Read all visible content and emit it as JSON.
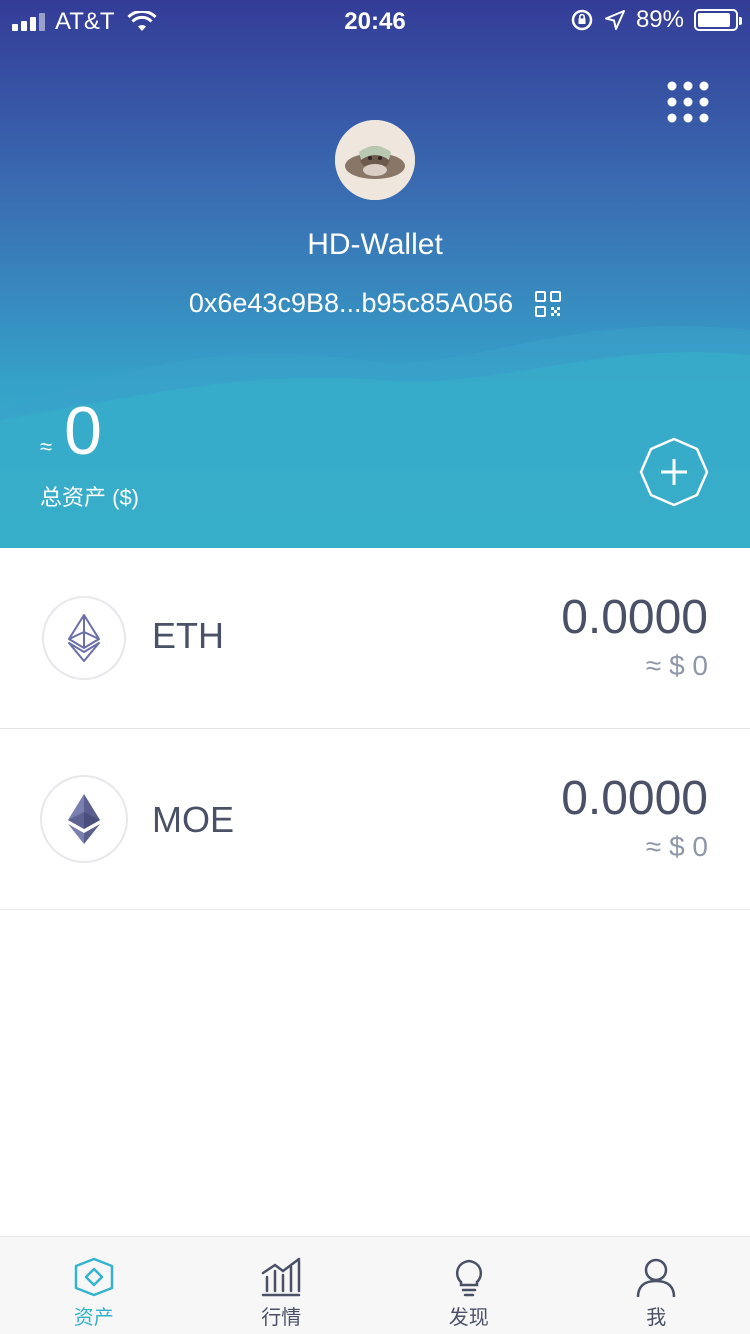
{
  "status_bar": {
    "carrier": "AT&T",
    "time": "20:46",
    "battery": "89%"
  },
  "header": {
    "wallet_name": "HD-Wallet",
    "address": "0x6e43c9B8...b95c85A056",
    "approx_symbol": "≈",
    "total_value": "0",
    "total_label": "总资产 ($)"
  },
  "assets": [
    {
      "symbol": "ETH",
      "balance": "0.0000",
      "fiat": "≈ $ 0",
      "icon": "ethereum-icon"
    },
    {
      "symbol": "MOE",
      "balance": "0.0000",
      "fiat": "≈ $ 0",
      "icon": "ethereum-icon"
    }
  ],
  "tabs": [
    {
      "label": "资产",
      "icon": "assets-icon",
      "active": true
    },
    {
      "label": "行情",
      "icon": "market-chart-icon",
      "active": false
    },
    {
      "label": "发现",
      "icon": "lightbulb-icon",
      "active": false
    },
    {
      "label": "我",
      "icon": "user-icon",
      "active": false
    }
  ],
  "colors": {
    "header_top": "#343c97",
    "header_bottom": "#38b7c9",
    "accent": "#35b3cc",
    "text_dark": "#4a5166",
    "text_muted": "#8f96a8"
  }
}
